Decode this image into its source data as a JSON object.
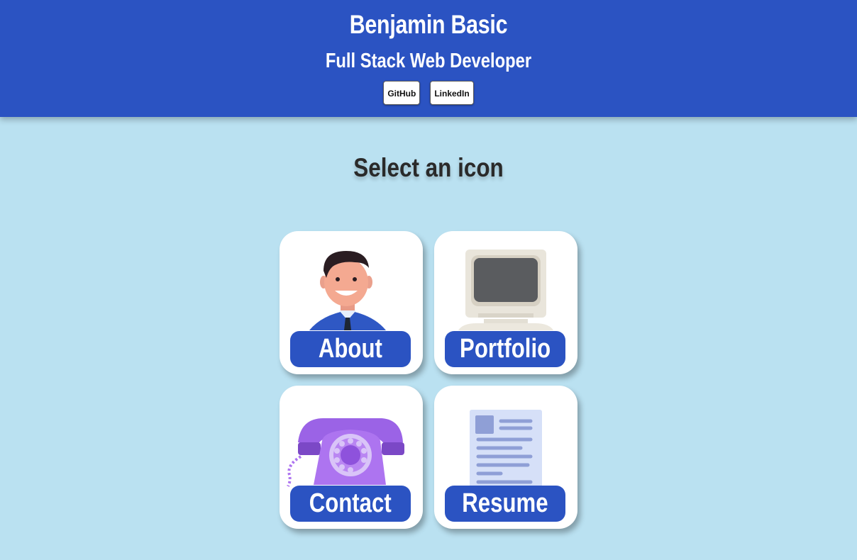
{
  "header": {
    "name": "Benjamin Basic",
    "role": "Full Stack Web Developer",
    "links": [
      {
        "label": "GitHub"
      },
      {
        "label": "LinkedIn"
      }
    ]
  },
  "main": {
    "prompt": "Select an icon",
    "tiles": [
      {
        "label": "About",
        "icon": "person-icon"
      },
      {
        "label": "Portfolio",
        "icon": "computer-icon"
      },
      {
        "label": "Contact",
        "icon": "telephone-icon"
      },
      {
        "label": "Resume",
        "icon": "document-icon"
      }
    ]
  },
  "colors": {
    "header_bg": "#2b53c2",
    "page_bg": "#bae1f1",
    "tile_bg": "#ffffff",
    "label_bg": "#2b53c2"
  }
}
